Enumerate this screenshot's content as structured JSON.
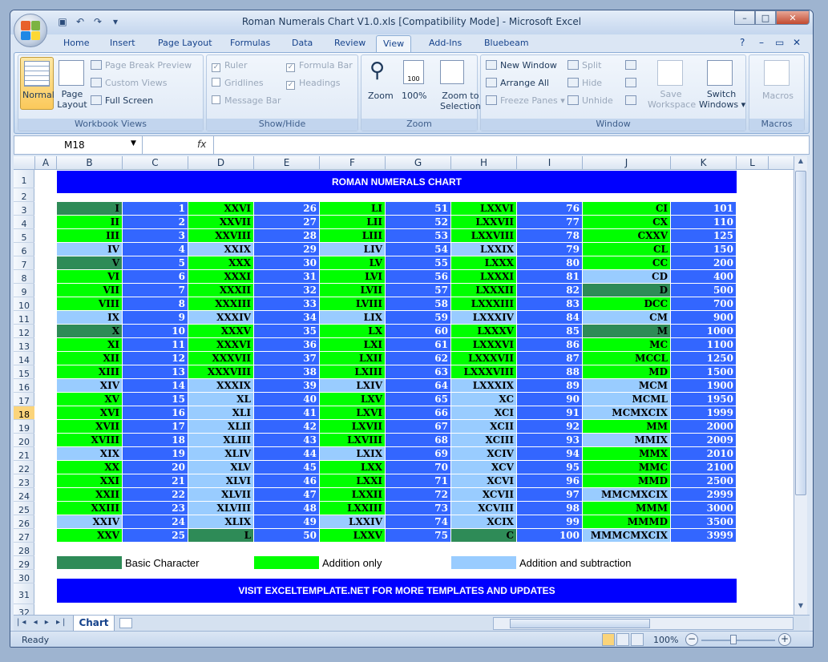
{
  "window": {
    "title": "Roman Numerals Chart V1.0.xls  [Compatibility Mode] - Microsoft Excel",
    "controls": {
      "minimize": "–",
      "maximize": "□",
      "close": "✕"
    }
  },
  "ribbon_tabs": [
    "Home",
    "Insert",
    "Page Layout",
    "Formulas",
    "Data",
    "Review",
    "View",
    "Add-Ins",
    "Bluebeam"
  ],
  "active_tab": "View",
  "ribbon": {
    "workbook_views": {
      "label": "Workbook Views",
      "normal": "Normal",
      "page_layout": "Page Layout",
      "page_break_preview": "Page Break Preview",
      "custom_views": "Custom Views",
      "full_screen": "Full Screen"
    },
    "show_hide": {
      "label": "Show/Hide",
      "ruler": "Ruler",
      "gridlines": "Gridlines",
      "message_bar": "Message Bar",
      "formula_bar": "Formula Bar",
      "headings": "Headings"
    },
    "zoom": {
      "label": "Zoom",
      "zoom": "Zoom",
      "hundred": "100%",
      "zoom_to_selection_1": "Zoom to",
      "zoom_to_selection_2": "Selection"
    },
    "window": {
      "label": "Window",
      "new_window": "New Window",
      "arrange_all": "Arrange All",
      "freeze_panes": "Freeze Panes",
      "split": "Split",
      "hide": "Hide",
      "unhide": "Unhide",
      "save_workspace_1": "Save",
      "save_workspace_2": "Workspace",
      "switch_windows_1": "Switch",
      "switch_windows_2": "Windows"
    },
    "macros": {
      "label": "Macros",
      "macros": "Macros"
    }
  },
  "formula_bar": {
    "name_box": "M18",
    "fx": "fx",
    "formula": ""
  },
  "columns": [
    "A",
    "B",
    "C",
    "D",
    "E",
    "F",
    "G",
    "H",
    "I",
    "J",
    "K",
    "L"
  ],
  "rows": [
    "1",
    "2",
    "3",
    "4",
    "5",
    "6",
    "7",
    "8",
    "9",
    "10",
    "11",
    "12",
    "13",
    "14",
    "15",
    "16",
    "17",
    "18",
    "19",
    "20",
    "21",
    "22",
    "23",
    "24",
    "25",
    "26",
    "27",
    "28",
    "29",
    "30",
    "31",
    "32"
  ],
  "selected_row": "18",
  "colors": {
    "basic": "#2e8b57",
    "addition": "#00ff00",
    "subtraction": "#99ccff",
    "number_bg": "#3366ff",
    "banner": "#0000ff"
  },
  "sheet": {
    "title": "ROMAN NUMERALS CHART",
    "footer": "VISIT EXCELTEMPLATE.NET FOR MORE TEMPLATES AND UPDATES",
    "legend": [
      {
        "type": "basic",
        "label": "Basic Character"
      },
      {
        "type": "addition",
        "label": "Addition only"
      },
      {
        "type": "subtraction",
        "label": "Addition and subtraction"
      }
    ],
    "table": [
      [
        [
          "I",
          "b",
          "1"
        ],
        [
          "XXVI",
          "a",
          "26"
        ],
        [
          "LI",
          "a",
          "51"
        ],
        [
          "LXXVI",
          "a",
          "76"
        ],
        [
          "CI",
          "a",
          "101"
        ]
      ],
      [
        [
          "II",
          "a",
          "2"
        ],
        [
          "XXVII",
          "a",
          "27"
        ],
        [
          "LII",
          "a",
          "52"
        ],
        [
          "LXXVII",
          "a",
          "77"
        ],
        [
          "CX",
          "a",
          "110"
        ]
      ],
      [
        [
          "III",
          "a",
          "3"
        ],
        [
          "XXVIII",
          "a",
          "28"
        ],
        [
          "LIII",
          "a",
          "53"
        ],
        [
          "LXXVIII",
          "a",
          "78"
        ],
        [
          "CXXV",
          "a",
          "125"
        ]
      ],
      [
        [
          "IV",
          "s",
          "4"
        ],
        [
          "XXIX",
          "s",
          "29"
        ],
        [
          "LIV",
          "s",
          "54"
        ],
        [
          "LXXIX",
          "s",
          "79"
        ],
        [
          "CL",
          "a",
          "150"
        ]
      ],
      [
        [
          "V",
          "b",
          "5"
        ],
        [
          "XXX",
          "a",
          "30"
        ],
        [
          "LV",
          "a",
          "55"
        ],
        [
          "LXXX",
          "a",
          "80"
        ],
        [
          "CC",
          "a",
          "200"
        ]
      ],
      [
        [
          "VI",
          "a",
          "6"
        ],
        [
          "XXXI",
          "a",
          "31"
        ],
        [
          "LVI",
          "a",
          "56"
        ],
        [
          "LXXXI",
          "a",
          "81"
        ],
        [
          "CD",
          "s",
          "400"
        ]
      ],
      [
        [
          "VII",
          "a",
          "7"
        ],
        [
          "XXXII",
          "a",
          "32"
        ],
        [
          "LVII",
          "a",
          "57"
        ],
        [
          "LXXXII",
          "a",
          "82"
        ],
        [
          "D",
          "b",
          "500"
        ]
      ],
      [
        [
          "VIII",
          "a",
          "8"
        ],
        [
          "XXXIII",
          "a",
          "33"
        ],
        [
          "LVIII",
          "a",
          "58"
        ],
        [
          "LXXXIII",
          "a",
          "83"
        ],
        [
          "DCC",
          "a",
          "700"
        ]
      ],
      [
        [
          "IX",
          "s",
          "9"
        ],
        [
          "XXXIV",
          "s",
          "34"
        ],
        [
          "LIX",
          "s",
          "59"
        ],
        [
          "LXXXIV",
          "s",
          "84"
        ],
        [
          "CM",
          "s",
          "900"
        ]
      ],
      [
        [
          "X",
          "b",
          "10"
        ],
        [
          "XXXV",
          "a",
          "35"
        ],
        [
          "LX",
          "a",
          "60"
        ],
        [
          "LXXXV",
          "a",
          "85"
        ],
        [
          "M",
          "b",
          "1000"
        ]
      ],
      [
        [
          "XI",
          "a",
          "11"
        ],
        [
          "XXXVI",
          "a",
          "36"
        ],
        [
          "LXI",
          "a",
          "61"
        ],
        [
          "LXXXVI",
          "a",
          "86"
        ],
        [
          "MC",
          "a",
          "1100"
        ]
      ],
      [
        [
          "XII",
          "a",
          "12"
        ],
        [
          "XXXVII",
          "a",
          "37"
        ],
        [
          "LXII",
          "a",
          "62"
        ],
        [
          "LXXXVII",
          "a",
          "87"
        ],
        [
          "MCCL",
          "a",
          "1250"
        ]
      ],
      [
        [
          "XIII",
          "a",
          "13"
        ],
        [
          "XXXVIII",
          "a",
          "38"
        ],
        [
          "LXIII",
          "a",
          "63"
        ],
        [
          "LXXXVIII",
          "a",
          "88"
        ],
        [
          "MD",
          "a",
          "1500"
        ]
      ],
      [
        [
          "XIV",
          "s",
          "14"
        ],
        [
          "XXXIX",
          "s",
          "39"
        ],
        [
          "LXIV",
          "s",
          "64"
        ],
        [
          "LXXXIX",
          "s",
          "89"
        ],
        [
          "MCM",
          "s",
          "1900"
        ]
      ],
      [
        [
          "XV",
          "a",
          "15"
        ],
        [
          "XL",
          "s",
          "40"
        ],
        [
          "LXV",
          "a",
          "65"
        ],
        [
          "XC",
          "s",
          "90"
        ],
        [
          "MCML",
          "s",
          "1950"
        ]
      ],
      [
        [
          "XVI",
          "a",
          "16"
        ],
        [
          "XLI",
          "s",
          "41"
        ],
        [
          "LXVI",
          "a",
          "66"
        ],
        [
          "XCI",
          "s",
          "91"
        ],
        [
          "MCMXCIX",
          "s",
          "1999"
        ]
      ],
      [
        [
          "XVII",
          "a",
          "17"
        ],
        [
          "XLII",
          "s",
          "42"
        ],
        [
          "LXVII",
          "a",
          "67"
        ],
        [
          "XCII",
          "s",
          "92"
        ],
        [
          "MM",
          "a",
          "2000"
        ]
      ],
      [
        [
          "XVIII",
          "a",
          "18"
        ],
        [
          "XLIII",
          "s",
          "43"
        ],
        [
          "LXVIII",
          "a",
          "68"
        ],
        [
          "XCIII",
          "s",
          "93"
        ],
        [
          "MMIX",
          "s",
          "2009"
        ]
      ],
      [
        [
          "XIX",
          "s",
          "19"
        ],
        [
          "XLIV",
          "s",
          "44"
        ],
        [
          "LXIX",
          "s",
          "69"
        ],
        [
          "XCIV",
          "s",
          "94"
        ],
        [
          "MMX",
          "a",
          "2010"
        ]
      ],
      [
        [
          "XX",
          "a",
          "20"
        ],
        [
          "XLV",
          "s",
          "45"
        ],
        [
          "LXX",
          "a",
          "70"
        ],
        [
          "XCV",
          "s",
          "95"
        ],
        [
          "MMC",
          "a",
          "2100"
        ]
      ],
      [
        [
          "XXI",
          "a",
          "21"
        ],
        [
          "XLVI",
          "s",
          "46"
        ],
        [
          "LXXI",
          "a",
          "71"
        ],
        [
          "XCVI",
          "s",
          "96"
        ],
        [
          "MMD",
          "a",
          "2500"
        ]
      ],
      [
        [
          "XXII",
          "a",
          "22"
        ],
        [
          "XLVII",
          "s",
          "47"
        ],
        [
          "LXXII",
          "a",
          "72"
        ],
        [
          "XCVII",
          "s",
          "97"
        ],
        [
          "MMCMXCIX",
          "s",
          "2999"
        ]
      ],
      [
        [
          "XXIII",
          "a",
          "23"
        ],
        [
          "XLVIII",
          "s",
          "48"
        ],
        [
          "LXXIII",
          "a",
          "73"
        ],
        [
          "XCVIII",
          "s",
          "98"
        ],
        [
          "MMM",
          "a",
          "3000"
        ]
      ],
      [
        [
          "XXIV",
          "s",
          "24"
        ],
        [
          "XLIX",
          "s",
          "49"
        ],
        [
          "LXXIV",
          "s",
          "74"
        ],
        [
          "XCIX",
          "s",
          "99"
        ],
        [
          "MMMD",
          "a",
          "3500"
        ]
      ],
      [
        [
          "XXV",
          "a",
          "25"
        ],
        [
          "L",
          "b",
          "50"
        ],
        [
          "LXXV",
          "a",
          "75"
        ],
        [
          "C",
          "b",
          "100"
        ],
        [
          "MMMCMXCIX",
          "s",
          "3999"
        ]
      ]
    ]
  },
  "sheet_tabs": {
    "active": "Chart",
    "nav": "|◂ ◂ ▸ ▸|"
  },
  "status": {
    "ready": "Ready",
    "zoom": "100%",
    "minus": "−",
    "plus": "+"
  }
}
